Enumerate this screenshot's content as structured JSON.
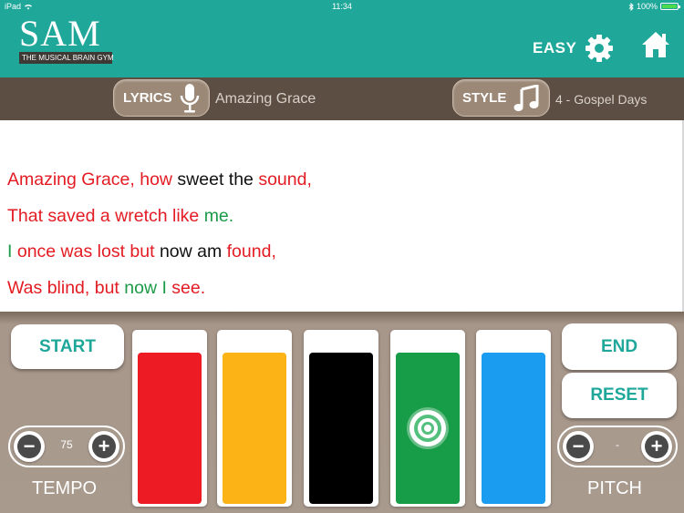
{
  "status_bar": {
    "device": "iPad",
    "time": "11:34",
    "battery": "100%",
    "battery_level": 1.0
  },
  "header": {
    "logo": "SAM",
    "tagline": "THE MUSICAL BRAIN GYM",
    "level": "EASY",
    "icons": [
      "gear-icon",
      "home-icon"
    ]
  },
  "selection": {
    "lyrics_label": "LYRICS",
    "lyrics_value": "Amazing Grace",
    "style_label": "STYLE",
    "style_value": "4 - Gospel Days",
    "icons": [
      "microphone-icon",
      "music-note-icon"
    ]
  },
  "lyrics": {
    "lines": [
      [
        {
          "text": "Amazing Grace, how ",
          "color": "red"
        },
        {
          "text": "sweet the ",
          "color": "black"
        },
        {
          "text": "sound,",
          "color": "red"
        }
      ],
      [
        {
          "text": "That saved a wretch like ",
          "color": "red"
        },
        {
          "text": "me.",
          "color": "green"
        }
      ],
      [
        {
          "text": "I ",
          "color": "green"
        },
        {
          "text": "once was lost but ",
          "color": "red"
        },
        {
          "text": "now am ",
          "color": "black"
        },
        {
          "text": "found,",
          "color": "red"
        }
      ],
      [
        {
          "text": "Was blind, but ",
          "color": "red"
        },
        {
          "text": "now I ",
          "color": "green"
        },
        {
          "text": "see.",
          "color": "red"
        }
      ]
    ]
  },
  "controls": {
    "start_label": "START",
    "end_label": "END",
    "reset_label": "RESET",
    "tempo_label": "TEMPO",
    "tempo_value": "75",
    "pitch_label": "PITCH",
    "pitch_value": "-",
    "minus_glyph": "−",
    "plus_glyph": "+"
  },
  "keys": [
    {
      "color": "#ed1c24",
      "active": false
    },
    {
      "color": "#fbb315",
      "active": false
    },
    {
      "color": "#000000",
      "active": false
    },
    {
      "color": "#179c48",
      "active": true
    },
    {
      "color": "#1a9cf0",
      "active": false
    }
  ],
  "colors": {
    "teal": "#1fa79a",
    "brown": "#5c4e42",
    "red": "#e31b23",
    "green": "#1b9a48",
    "black": "#111111"
  }
}
